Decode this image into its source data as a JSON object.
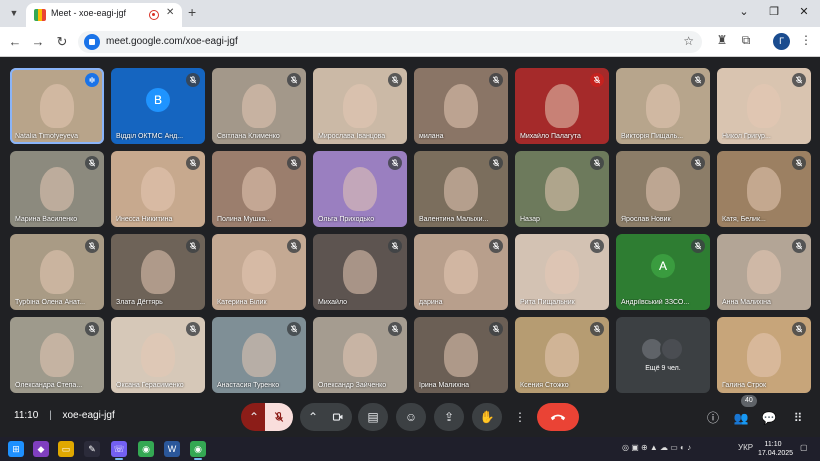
{
  "browser": {
    "tab_title": "Meet - xoe-eagi-jgf",
    "url": "meet.google.com/xoe-eagi-jgf",
    "profile_initial": "Г"
  },
  "participants": [
    {
      "name": "Natalia Timofyeyeva",
      "mic": "speaking",
      "bg": "#b8a48a",
      "speaking": true
    },
    {
      "name": "Відділ ОКТМС Анд...",
      "mic": "muted",
      "bg": "#1565c0",
      "avatar": "В",
      "avatar_bg": "#1976d2"
    },
    {
      "name": "Світлана Клименко",
      "mic": "muted",
      "bg": "#a3988a"
    },
    {
      "name": "Мирослава Іванцова",
      "mic": "muted",
      "bg": "#cbb9a6"
    },
    {
      "name": "милана",
      "mic": "muted",
      "bg": "#8a7566"
    },
    {
      "name": "Михайло Палагута",
      "mic": "red",
      "bg": "#a52a2a"
    },
    {
      "name": "Викторія Пищаль...",
      "mic": "muted",
      "bg": "#b7a58c"
    },
    {
      "name": "Никол Григур...",
      "mic": "muted",
      "bg": "#d9c4b0"
    },
    {
      "name": "Марина Василенко",
      "mic": "muted",
      "bg": "#8c8a7e"
    },
    {
      "name": "Инесса Никитина",
      "mic": "muted",
      "bg": "#c7a98e"
    },
    {
      "name": "Полина Мушка...",
      "mic": "muted",
      "bg": "#9b7e6d"
    },
    {
      "name": "Ольга Приходько",
      "mic": "muted",
      "bg": "#9a7fc0"
    },
    {
      "name": "Валентина Малыхи...",
      "mic": "muted",
      "bg": "#7b6e5d"
    },
    {
      "name": "Назар",
      "mic": "muted",
      "bg": "#6d7a5c"
    },
    {
      "name": "Ярослав Новик",
      "mic": "muted",
      "bg": "#8c7d68"
    },
    {
      "name": "Катя, Белик...",
      "mic": "muted",
      "bg": "#9c8062"
    },
    {
      "name": "Турбіна Олена Анат...",
      "mic": "muted",
      "bg": "#a99b85"
    },
    {
      "name": "Злата Дёгтярь",
      "mic": "muted",
      "bg": "#6e6358"
    },
    {
      "name": "Катерина Білик",
      "mic": "muted",
      "bg": "#c4a993"
    },
    {
      "name": "Михайло",
      "mic": "muted",
      "bg": "#5d5450"
    },
    {
      "name": "дарина",
      "mic": "muted",
      "bg": "#b89f8c"
    },
    {
      "name": "Рита Пищальник",
      "mic": "muted",
      "bg": "#d3c2b3"
    },
    {
      "name": "Андріївський ЗЗСО...",
      "mic": "green",
      "bg": "#2e7d32",
      "avatar": "A",
      "avatar_bg": "#2e7d32"
    },
    {
      "name": "Анна Малихіна",
      "mic": "muted",
      "bg": "#b3a596"
    },
    {
      "name": "Олександра Степа...",
      "mic": "muted",
      "bg": "#9e9a8c"
    },
    {
      "name": "Оксана Герасименко",
      "mic": "muted",
      "bg": "#d6c8b8"
    },
    {
      "name": "Анастасия Туренко",
      "mic": "muted",
      "bg": "#7f8f96"
    },
    {
      "name": "Олександр Зайченко",
      "mic": "muted",
      "bg": "#a59c90"
    },
    {
      "name": "Ірина Малихіна",
      "mic": "muted",
      "bg": "#6b5f55"
    },
    {
      "name": "Ксения Стожко",
      "mic": "muted",
      "bg": "#b69c72"
    },
    {
      "name": "",
      "mic": "none",
      "bg": "#3c4043",
      "more": true
    },
    {
      "name": "Галина Строк",
      "mic": "muted",
      "bg": "#c7a57a"
    }
  ],
  "more_tile": {
    "label": "Ещё 9 чел."
  },
  "controls": {
    "time": "11:10",
    "meeting_code": "xoe-eagi-jgf",
    "participants_count": "40"
  },
  "taskbar": {
    "language": "УКР",
    "time": "11:10",
    "date": "17.04.2025"
  },
  "colors": {
    "meet_bg": "#202124",
    "accent": "#8ab4f8",
    "end_call": "#ea4335"
  }
}
